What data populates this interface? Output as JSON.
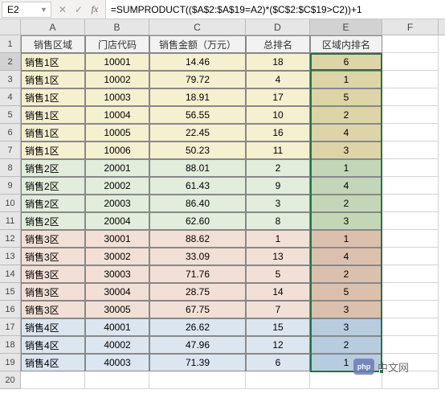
{
  "nameBox": "E2",
  "formula": "=SUMPRODUCT(($A$2:$A$19=A2)*($C$2:$C$19>C2))+1",
  "columns": [
    "A",
    "B",
    "C",
    "D",
    "E",
    "F"
  ],
  "activeCol": "E",
  "headers": {
    "A": "销售区域",
    "B": "门店代码",
    "C": "销售金额（万元）",
    "D": "总排名",
    "E": "区域内排名"
  },
  "rows": [
    {
      "n": 2,
      "region": "销售1区",
      "code": "10001",
      "amount": "14.46",
      "rank": "18",
      "rrank": "6",
      "cls": "r1"
    },
    {
      "n": 3,
      "region": "销售1区",
      "code": "10002",
      "amount": "79.72",
      "rank": "4",
      "rrank": "1",
      "cls": "r1"
    },
    {
      "n": 4,
      "region": "销售1区",
      "code": "10003",
      "amount": "18.91",
      "rank": "17",
      "rrank": "5",
      "cls": "r1"
    },
    {
      "n": 5,
      "region": "销售1区",
      "code": "10004",
      "amount": "56.55",
      "rank": "10",
      "rrank": "2",
      "cls": "r1"
    },
    {
      "n": 6,
      "region": "销售1区",
      "code": "10005",
      "amount": "22.45",
      "rank": "16",
      "rrank": "4",
      "cls": "r1"
    },
    {
      "n": 7,
      "region": "销售1区",
      "code": "10006",
      "amount": "50.23",
      "rank": "11",
      "rrank": "3",
      "cls": "r1"
    },
    {
      "n": 8,
      "region": "销售2区",
      "code": "20001",
      "amount": "88.01",
      "rank": "2",
      "rrank": "1",
      "cls": "r2"
    },
    {
      "n": 9,
      "region": "销售2区",
      "code": "20002",
      "amount": "61.43",
      "rank": "9",
      "rrank": "4",
      "cls": "r2"
    },
    {
      "n": 10,
      "region": "销售2区",
      "code": "20003",
      "amount": "86.40",
      "rank": "3",
      "rrank": "2",
      "cls": "r2"
    },
    {
      "n": 11,
      "region": "销售2区",
      "code": "20004",
      "amount": "62.60",
      "rank": "8",
      "rrank": "3",
      "cls": "r2"
    },
    {
      "n": 12,
      "region": "销售3区",
      "code": "30001",
      "amount": "88.62",
      "rank": "1",
      "rrank": "1",
      "cls": "r3"
    },
    {
      "n": 13,
      "region": "销售3区",
      "code": "30002",
      "amount": "33.09",
      "rank": "13",
      "rrank": "4",
      "cls": "r3"
    },
    {
      "n": 14,
      "region": "销售3区",
      "code": "30003",
      "amount": "71.76",
      "rank": "5",
      "rrank": "2",
      "cls": "r3"
    },
    {
      "n": 15,
      "region": "销售3区",
      "code": "30004",
      "amount": "28.75",
      "rank": "14",
      "rrank": "5",
      "cls": "r3"
    },
    {
      "n": 16,
      "region": "销售3区",
      "code": "30005",
      "amount": "67.75",
      "rank": "7",
      "rrank": "3",
      "cls": "r3"
    },
    {
      "n": 17,
      "region": "销售4区",
      "code": "40001",
      "amount": "26.62",
      "rank": "15",
      "rrank": "3",
      "cls": "r4"
    },
    {
      "n": 18,
      "region": "销售4区",
      "code": "40002",
      "amount": "47.96",
      "rank": "12",
      "rrank": "2",
      "cls": "r4"
    },
    {
      "n": 19,
      "region": "销售4区",
      "code": "40003",
      "amount": "71.39",
      "rank": "6",
      "rrank": "1",
      "cls": "r4"
    }
  ],
  "emptyRow": 20,
  "watermark": "中文网"
}
